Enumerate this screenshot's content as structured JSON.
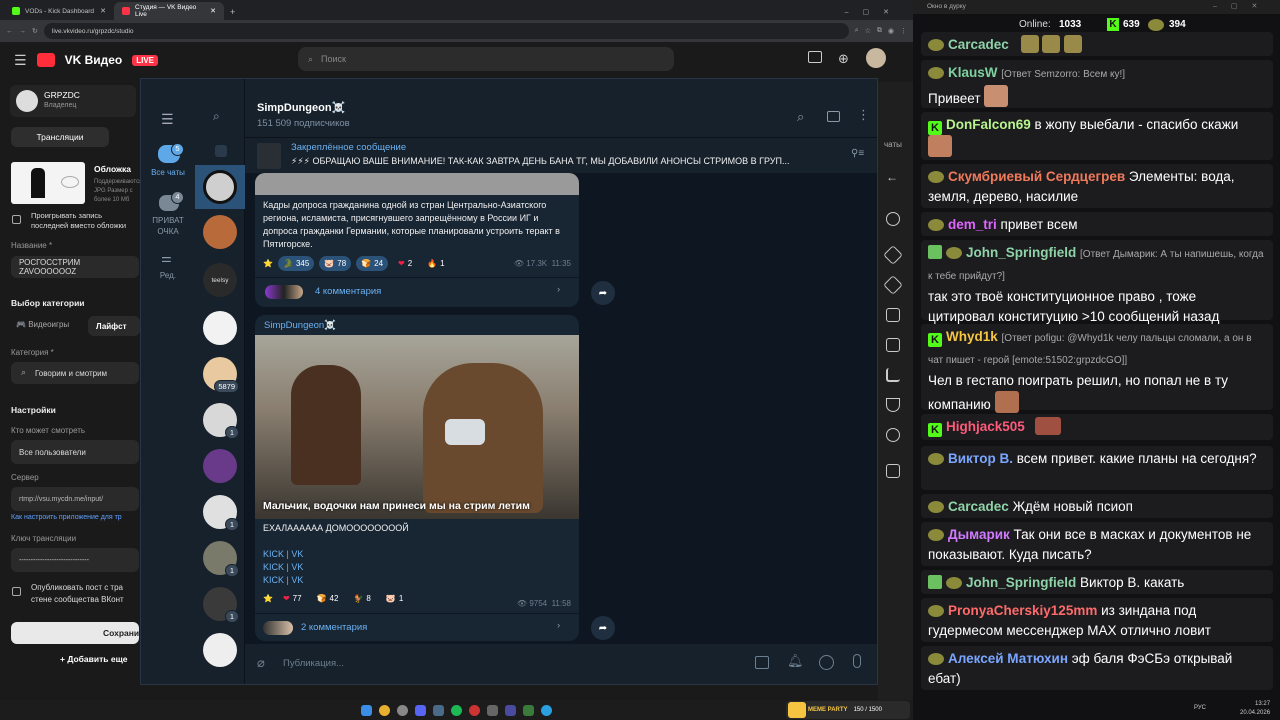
{
  "browser": {
    "tabs": [
      {
        "title": "VODs - Kick Dashboard",
        "color": "#53fc18"
      },
      {
        "title": "Студия — VK Видео Live",
        "color": "#ff3347"
      }
    ],
    "new_tab": "+",
    "url": "live.vkvideo.ru/grpzdc/studio"
  },
  "vk": {
    "brand": "VK Видео",
    "live_badge": "LIVE",
    "search_placeholder": "Поиск",
    "channel": {
      "name": "GRPZDC",
      "role": "Владелец"
    },
    "broadcasts_tab": "Трансляции",
    "cover_title": "Обложка",
    "cover_hint": "Поддерживаются JPG Размер с более 10 Мб",
    "play_record_label": "Проигрывать запись последней вместо обложки",
    "name_label": "Название *",
    "name_value": "РОСГОССТРИМ ZAVOOOOOOZ",
    "category_choice_label": "Выбор категории",
    "cat_tabs": [
      "Видеоигры",
      "Лайфст"
    ],
    "category_label": "Категория *",
    "category_value": "Говорим и смотрим",
    "settings_label": "Настройки",
    "who_can_watch_label": "Кто может смотреть",
    "who_can_watch_value": "Все пользователи",
    "server_label": "Сервер",
    "server_value": "rtmp://vsu.mycdn.me/input/",
    "setup_link": "Как настроить приложение для тр",
    "key_label": "Ключ трансляции",
    "key_value": "------------------------------",
    "publish_label": "Опубликовать пост с тра стене сообщества ВКонт",
    "save_button": "Сохрани",
    "add_more": "Добавить еще",
    "chats_tab": "чаты"
  },
  "telegram": {
    "folders": [
      {
        "label": "Все чаты",
        "badge": "5"
      },
      {
        "label": "ПРИВАТ ОЧКА",
        "badge": "4"
      },
      {
        "label": "Ред.",
        "badge": ""
      }
    ],
    "avatar_badges": [
      "",
      "",
      "",
      "",
      "5879",
      "1",
      "",
      "1",
      "1",
      "1",
      ""
    ],
    "avatar_text": "teelsy",
    "channel_name": "SimpDungeon☠️",
    "subscribers": "151 509 подписчиков",
    "pinned_title": "Закреплённое сообщение",
    "pinned_text": "⚡⚡⚡ ОБРАЩАЮ ВАШЕ ВНИМАНИЕ!  ТАК-КАК ЗАВТРА ДЕНЬ БАНА ТГ, МЫ ДОБАВИЛИ АНОНСЫ СТРИМОВ В ГРУП...",
    "post1": {
      "text": "Кадры допроса гражданина одной из стран Центрально-Азиатского региона, исламиста, присягнувшего запрещённому в России ИГ и допроса гражданки Германии, которые планировали устроить теракт в Пятигорске.",
      "reactions": [
        {
          "emoji": "⭐",
          "count": ""
        },
        {
          "emoji": "🐊",
          "count": "345"
        },
        {
          "emoji": "🐷",
          "count": "78"
        },
        {
          "emoji": "🍞",
          "count": "24"
        },
        {
          "emoji": "❤",
          "count": "2"
        },
        {
          "emoji": "🔥",
          "count": "1"
        }
      ],
      "views": "17.3K",
      "time": "11:35",
      "comments": "4 комментария"
    },
    "post2": {
      "author": "SimpDungeon☠️",
      "caption": "Мальчик, водочки нам принеси  мы на стрим летим",
      "text": "ЕХАЛАААААА ДОМООООООООЙ",
      "links": [
        "KICK | VK",
        "KICK | VK",
        "KICK | VK"
      ],
      "reactions": [
        {
          "emoji": "⭐",
          "count": ""
        },
        {
          "emoji": "❤",
          "count": "77"
        },
        {
          "emoji": "🍞",
          "count": "42"
        },
        {
          "emoji": "🐓",
          "count": "8"
        },
        {
          "emoji": "🐷",
          "count": "1"
        }
      ],
      "views": "9754",
      "time": "11:58",
      "comments": "2 комментария"
    },
    "input_placeholder": "Публикация..."
  },
  "chat": {
    "window_title": "Окно в дурку",
    "online_label": "Online:",
    "online": "1033",
    "kick_count": "639",
    "sub_count": "394",
    "messages": [
      {
        "user": "Carcadec",
        "color": "#8fd3a8",
        "reply": "",
        "text": ""
      },
      {
        "user": "KlausW",
        "color": "#7fd1a0",
        "reply": "[Ответ Semzorro: Всем ку!]",
        "text": "Привеет"
      },
      {
        "user": "DonFalcon69",
        "color": "#b8f58c",
        "reply": "",
        "text": "в жопу выебали - спасибо скажи"
      },
      {
        "user": "Скумбриевый Сердцегрев",
        "color": "#f07a5a",
        "reply": "",
        "text": "Элементы: вода, земля, дерево,  насилие"
      },
      {
        "user": "dem_tri",
        "color": "#e065ff",
        "reply": "",
        "text": "привет всем"
      },
      {
        "user": "John_Springfield",
        "color": "#8fd3a8",
        "reply": "[Ответ Дымарик: А ты напишешь, когда к тебе прийдут?]",
        "text": "так это твоё конституционное право , тоже цитировал конституцию >10 сообщений назад"
      },
      {
        "user": "Whyd1k",
        "color": "#f5c542",
        "reply": "[Ответ pofigu: @Whyd1k челу пальцы сломали, а он в чат пишет - герой [emote:51502:grpzdcGO]]",
        "text": "Чел в гестапо поиграть решил, но попал не в ту компанию"
      },
      {
        "user": "Highjack505",
        "color": "#ff5a7a",
        "reply": "",
        "text": ""
      },
      {
        "user": "Виктор В.",
        "color": "#7aa6ff",
        "reply": "",
        "text": "всем привет. какие планы на сегодня?"
      },
      {
        "user": "Carcadec",
        "color": "#8fd3a8",
        "reply": "",
        "text": "Ждём новый псиоп"
      },
      {
        "user": "Дымарик",
        "color": "#d07aff",
        "reply": "",
        "text": "Так они все в масках и документов не показывают. Куда писать?"
      },
      {
        "user": "John_Springfield",
        "color": "#8fd3a8",
        "reply": "",
        "text": "Виктор В. какать"
      },
      {
        "user": "PronyaCherskiy125mm",
        "color": "#ff6a6a",
        "reply": "",
        "text": "из зиндана под гудермесом мессенджер MAX отлично ловит"
      },
      {
        "user": "Алексей Матюхин",
        "color": "#7aa6ff",
        "reply": "",
        "text": "эф баля ФэСБэ открывай ебат)"
      }
    ]
  },
  "taskbar": {
    "widget": "MEME PARTY",
    "widget_stat": "150 / 1500",
    "lang": "РУС",
    "time": "13:27",
    "date": "20.04.2026"
  },
  "colors": {
    "accent": "#6ab2f2",
    "kick": "#53fc18",
    "vk_live": "#ff3347",
    "tg_bg": "#0e1621"
  }
}
